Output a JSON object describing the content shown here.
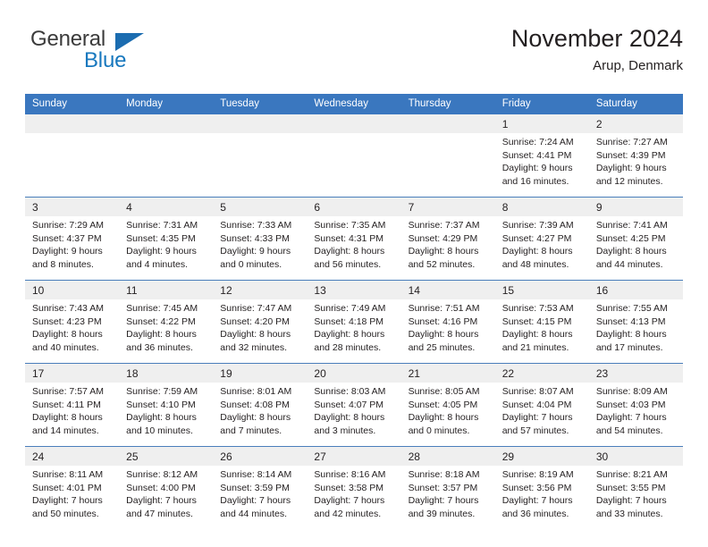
{
  "brand": {
    "name_part1": "General",
    "name_part2": "Blue",
    "triangle_color": "#1b6cb0",
    "blue_color": "#1878be"
  },
  "header": {
    "title": "November 2024",
    "location": "Arup, Denmark"
  },
  "theme": {
    "header_bar": "#3a77bf",
    "daynum_band": "#efefef",
    "row_rule": "#4a7ebb",
    "text": "#231f20"
  },
  "weekdays": [
    "Sunday",
    "Monday",
    "Tuesday",
    "Wednesday",
    "Thursday",
    "Friday",
    "Saturday"
  ],
  "weeks": [
    [
      {
        "day": "",
        "sunrise": "",
        "sunset": "",
        "daylight1": "",
        "daylight2": ""
      },
      {
        "day": "",
        "sunrise": "",
        "sunset": "",
        "daylight1": "",
        "daylight2": ""
      },
      {
        "day": "",
        "sunrise": "",
        "sunset": "",
        "daylight1": "",
        "daylight2": ""
      },
      {
        "day": "",
        "sunrise": "",
        "sunset": "",
        "daylight1": "",
        "daylight2": ""
      },
      {
        "day": "",
        "sunrise": "",
        "sunset": "",
        "daylight1": "",
        "daylight2": ""
      },
      {
        "day": "1",
        "sunrise": "Sunrise: 7:24 AM",
        "sunset": "Sunset: 4:41 PM",
        "daylight1": "Daylight: 9 hours",
        "daylight2": "and 16 minutes."
      },
      {
        "day": "2",
        "sunrise": "Sunrise: 7:27 AM",
        "sunset": "Sunset: 4:39 PM",
        "daylight1": "Daylight: 9 hours",
        "daylight2": "and 12 minutes."
      }
    ],
    [
      {
        "day": "3",
        "sunrise": "Sunrise: 7:29 AM",
        "sunset": "Sunset: 4:37 PM",
        "daylight1": "Daylight: 9 hours",
        "daylight2": "and 8 minutes."
      },
      {
        "day": "4",
        "sunrise": "Sunrise: 7:31 AM",
        "sunset": "Sunset: 4:35 PM",
        "daylight1": "Daylight: 9 hours",
        "daylight2": "and 4 minutes."
      },
      {
        "day": "5",
        "sunrise": "Sunrise: 7:33 AM",
        "sunset": "Sunset: 4:33 PM",
        "daylight1": "Daylight: 9 hours",
        "daylight2": "and 0 minutes."
      },
      {
        "day": "6",
        "sunrise": "Sunrise: 7:35 AM",
        "sunset": "Sunset: 4:31 PM",
        "daylight1": "Daylight: 8 hours",
        "daylight2": "and 56 minutes."
      },
      {
        "day": "7",
        "sunrise": "Sunrise: 7:37 AM",
        "sunset": "Sunset: 4:29 PM",
        "daylight1": "Daylight: 8 hours",
        "daylight2": "and 52 minutes."
      },
      {
        "day": "8",
        "sunrise": "Sunrise: 7:39 AM",
        "sunset": "Sunset: 4:27 PM",
        "daylight1": "Daylight: 8 hours",
        "daylight2": "and 48 minutes."
      },
      {
        "day": "9",
        "sunrise": "Sunrise: 7:41 AM",
        "sunset": "Sunset: 4:25 PM",
        "daylight1": "Daylight: 8 hours",
        "daylight2": "and 44 minutes."
      }
    ],
    [
      {
        "day": "10",
        "sunrise": "Sunrise: 7:43 AM",
        "sunset": "Sunset: 4:23 PM",
        "daylight1": "Daylight: 8 hours",
        "daylight2": "and 40 minutes."
      },
      {
        "day": "11",
        "sunrise": "Sunrise: 7:45 AM",
        "sunset": "Sunset: 4:22 PM",
        "daylight1": "Daylight: 8 hours",
        "daylight2": "and 36 minutes."
      },
      {
        "day": "12",
        "sunrise": "Sunrise: 7:47 AM",
        "sunset": "Sunset: 4:20 PM",
        "daylight1": "Daylight: 8 hours",
        "daylight2": "and 32 minutes."
      },
      {
        "day": "13",
        "sunrise": "Sunrise: 7:49 AM",
        "sunset": "Sunset: 4:18 PM",
        "daylight1": "Daylight: 8 hours",
        "daylight2": "and 28 minutes."
      },
      {
        "day": "14",
        "sunrise": "Sunrise: 7:51 AM",
        "sunset": "Sunset: 4:16 PM",
        "daylight1": "Daylight: 8 hours",
        "daylight2": "and 25 minutes."
      },
      {
        "day": "15",
        "sunrise": "Sunrise: 7:53 AM",
        "sunset": "Sunset: 4:15 PM",
        "daylight1": "Daylight: 8 hours",
        "daylight2": "and 21 minutes."
      },
      {
        "day": "16",
        "sunrise": "Sunrise: 7:55 AM",
        "sunset": "Sunset: 4:13 PM",
        "daylight1": "Daylight: 8 hours",
        "daylight2": "and 17 minutes."
      }
    ],
    [
      {
        "day": "17",
        "sunrise": "Sunrise: 7:57 AM",
        "sunset": "Sunset: 4:11 PM",
        "daylight1": "Daylight: 8 hours",
        "daylight2": "and 14 minutes."
      },
      {
        "day": "18",
        "sunrise": "Sunrise: 7:59 AM",
        "sunset": "Sunset: 4:10 PM",
        "daylight1": "Daylight: 8 hours",
        "daylight2": "and 10 minutes."
      },
      {
        "day": "19",
        "sunrise": "Sunrise: 8:01 AM",
        "sunset": "Sunset: 4:08 PM",
        "daylight1": "Daylight: 8 hours",
        "daylight2": "and 7 minutes."
      },
      {
        "day": "20",
        "sunrise": "Sunrise: 8:03 AM",
        "sunset": "Sunset: 4:07 PM",
        "daylight1": "Daylight: 8 hours",
        "daylight2": "and 3 minutes."
      },
      {
        "day": "21",
        "sunrise": "Sunrise: 8:05 AM",
        "sunset": "Sunset: 4:05 PM",
        "daylight1": "Daylight: 8 hours",
        "daylight2": "and 0 minutes."
      },
      {
        "day": "22",
        "sunrise": "Sunrise: 8:07 AM",
        "sunset": "Sunset: 4:04 PM",
        "daylight1": "Daylight: 7 hours",
        "daylight2": "and 57 minutes."
      },
      {
        "day": "23",
        "sunrise": "Sunrise: 8:09 AM",
        "sunset": "Sunset: 4:03 PM",
        "daylight1": "Daylight: 7 hours",
        "daylight2": "and 54 minutes."
      }
    ],
    [
      {
        "day": "24",
        "sunrise": "Sunrise: 8:11 AM",
        "sunset": "Sunset: 4:01 PM",
        "daylight1": "Daylight: 7 hours",
        "daylight2": "and 50 minutes."
      },
      {
        "day": "25",
        "sunrise": "Sunrise: 8:12 AM",
        "sunset": "Sunset: 4:00 PM",
        "daylight1": "Daylight: 7 hours",
        "daylight2": "and 47 minutes."
      },
      {
        "day": "26",
        "sunrise": "Sunrise: 8:14 AM",
        "sunset": "Sunset: 3:59 PM",
        "daylight1": "Daylight: 7 hours",
        "daylight2": "and 44 minutes."
      },
      {
        "day": "27",
        "sunrise": "Sunrise: 8:16 AM",
        "sunset": "Sunset: 3:58 PM",
        "daylight1": "Daylight: 7 hours",
        "daylight2": "and 42 minutes."
      },
      {
        "day": "28",
        "sunrise": "Sunrise: 8:18 AM",
        "sunset": "Sunset: 3:57 PM",
        "daylight1": "Daylight: 7 hours",
        "daylight2": "and 39 minutes."
      },
      {
        "day": "29",
        "sunrise": "Sunrise: 8:19 AM",
        "sunset": "Sunset: 3:56 PM",
        "daylight1": "Daylight: 7 hours",
        "daylight2": "and 36 minutes."
      },
      {
        "day": "30",
        "sunrise": "Sunrise: 8:21 AM",
        "sunset": "Sunset: 3:55 PM",
        "daylight1": "Daylight: 7 hours",
        "daylight2": "and 33 minutes."
      }
    ]
  ]
}
